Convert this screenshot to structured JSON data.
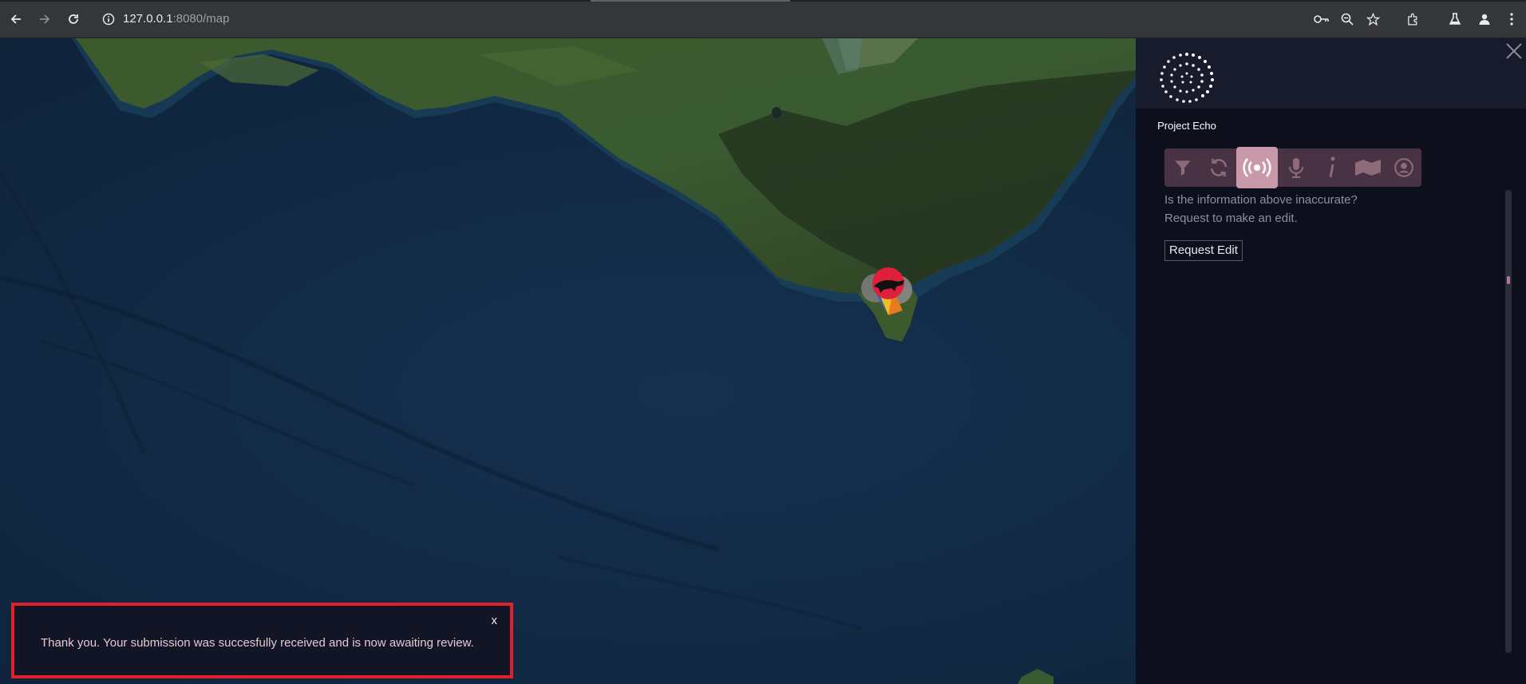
{
  "browser": {
    "url_host": "127.0.0.1",
    "url_path": ":8080/map",
    "icons": [
      "back-icon",
      "forward-icon",
      "reload-icon",
      "site-info-icon",
      "key-icon",
      "zoom-icon",
      "star-icon",
      "extensions-icon",
      "labs-icon",
      "profile-icon",
      "menu-icon"
    ]
  },
  "panel": {
    "logo_text": "Project Echo",
    "toolbar": [
      {
        "name": "filter-icon",
        "active": false
      },
      {
        "name": "sync-icon",
        "active": false
      },
      {
        "name": "broadcast-icon",
        "active": true
      },
      {
        "name": "microphone-icon",
        "active": false
      },
      {
        "name": "info-icon",
        "active": false
      },
      {
        "name": "map-icon",
        "active": false
      },
      {
        "name": "user-icon",
        "active": false
      }
    ],
    "question_line1": "Is the information above inaccurate?",
    "question_line2": "Request to make an edit.",
    "request_button": "Request Edit"
  },
  "toast": {
    "close_label": "x",
    "message": "Thank you. Your submission was succesfully received and is now awaiting review."
  },
  "colors": {
    "accent": "#c999aa",
    "toast_border": "#e0202a",
    "panel_bg": "#0d0f1c",
    "ocean": "#132a45"
  }
}
